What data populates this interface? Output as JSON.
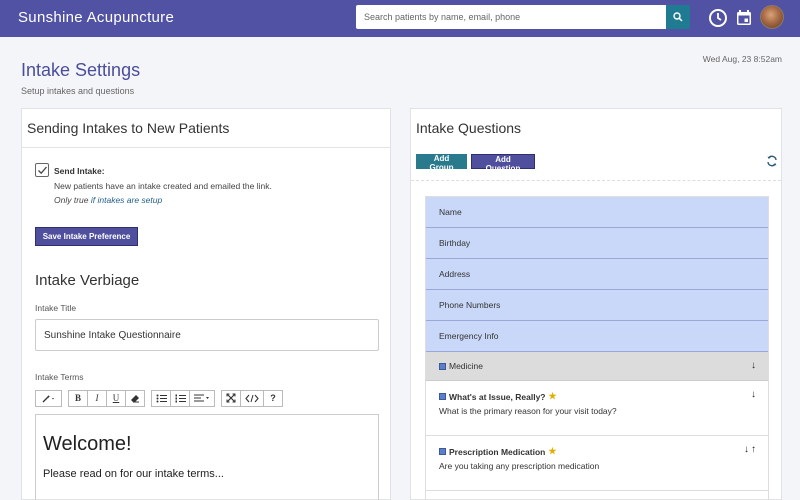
{
  "app": {
    "title": "Sunshine Acupuncture"
  },
  "search": {
    "placeholder": "Search patients by name, email, phone"
  },
  "header": {
    "title": "Intake Settings",
    "subtitle": "Setup intakes and questions",
    "datetime": "Wed Aug, 23 8:52am"
  },
  "left_panel": {
    "heading": "Sending Intakes to New Patients",
    "send_intake_label": "Send Intake:",
    "send_intake_desc": "New patients have an intake created and emailed the link.",
    "note_prefix": "Only true",
    "note_link": "if intakes are setup",
    "save_button": "Save Intake Preference",
    "verbiage_heading": "Intake Verbiage",
    "title_label": "Intake Title",
    "title_value": "Sunshine Intake Questionnaire",
    "terms_label": "Intake Terms",
    "editor_heading": "Welcome!",
    "editor_text": "Please read on for our intake terms..."
  },
  "toolbar": {
    "bold": "B",
    "italic": "I",
    "underline": "U",
    "help": "?"
  },
  "right_panel": {
    "heading": "Intake Questions",
    "add_group": "Add Group",
    "add_question": "Add Question",
    "fixed_rows": [
      "Name",
      "Birthday",
      "Address",
      "Phone Numbers",
      "Emergency Info"
    ],
    "group": "Medicine",
    "questions": [
      {
        "title": "What's at Issue, Really?",
        "desc": "What is the primary reason for your visit today?"
      },
      {
        "title": "Prescription Medication",
        "desc": "Are you taking any prescription medication"
      }
    ]
  },
  "colors": {
    "topbar": "#5152a3",
    "accent": "#4f4f9e",
    "teal": "#2a7a8e",
    "row_blue": "#c9d8f8"
  }
}
